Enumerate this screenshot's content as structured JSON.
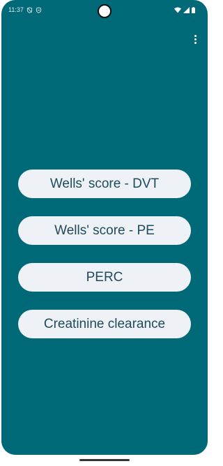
{
  "status_bar": {
    "time": "11:37",
    "left_icons": [
      "vpn-shield-icon",
      "no-sim-shield-icon"
    ],
    "right_icons": [
      "wifi-icon",
      "cell-signal-icon",
      "battery-icon"
    ]
  },
  "toolbar": {
    "overflow_icon": "more-vert-icon"
  },
  "menu": {
    "buttons": [
      {
        "label": "Wells' score - DVT"
      },
      {
        "label": "Wells' score - PE"
      },
      {
        "label": "PERC"
      },
      {
        "label": "Creatinine clearance"
      }
    ]
  },
  "colors": {
    "background": "#006978",
    "button_background": "#eef2f6",
    "button_text": "#214a5a"
  }
}
